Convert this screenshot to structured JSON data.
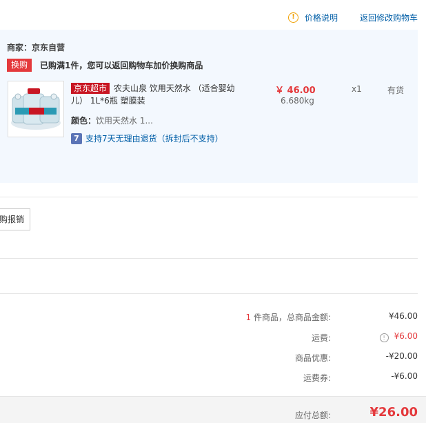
{
  "header": {
    "price_help_label": "价格说明",
    "back_to_cart_label": "返回修改购物车"
  },
  "order": {
    "merchant": "商家：京东自营",
    "exchange_badge": "换购",
    "exchange_text": "已购满1件，您可以返回购物车加价换购商品",
    "product": {
      "store_tag": "京东超市",
      "title": "农夫山泉 饮用天然水 （适合婴幼儿） 1L*6瓶 塑膜装",
      "price": "￥ 46.00",
      "weight": "6.680kg",
      "quantity": "x1",
      "stock": "有货",
      "color_label": "颜色：",
      "color_value": "饮用天然水 1...",
      "return_icon": "7",
      "return_policy": "支持7天无理由退货（拆封后不支持）"
    }
  },
  "reimburse_button_label": "购报销",
  "summary": {
    "count": "1",
    "count_label": " 件商品，总商品金额:",
    "goods_total": "¥46.00",
    "shipping_label": "运费:",
    "shipping_value": "¥6.00",
    "discount_label": "商品优惠:",
    "discount_value": "-¥20.00",
    "shipping_coupon_label": "运费券:",
    "shipping_coupon_value": "-¥6.00",
    "payable_label": "应付总额:",
    "payable_value": "¥26.00"
  },
  "colors": {
    "accent_red": "#e4393c",
    "link_blue": "#005ea7",
    "panel_bg": "#f3f8fe"
  }
}
